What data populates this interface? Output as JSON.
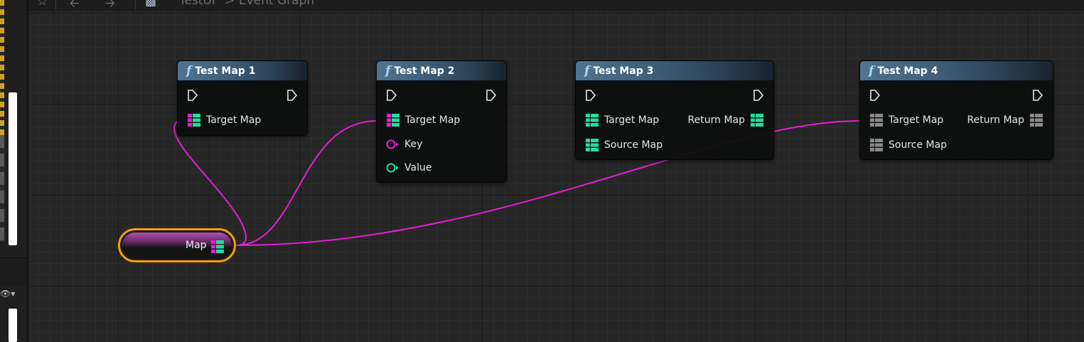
{
  "toolbar": {
    "breadcrumb_asset": "TestUI",
    "breadcrumb_separator": ">",
    "breadcrumb_graph": "Event Graph"
  },
  "colors": {
    "wire_map": "#e61ed7",
    "pin_map_key": "#e61ed7",
    "pin_map_value": "#1fe0a0",
    "pin_unlinked": "#8a8a8a",
    "var_node_border": "#f29d10"
  },
  "nodes": [
    {
      "title": "Test Map 1",
      "inputs": [
        {
          "label": "Target Map",
          "type": "map-linked"
        }
      ],
      "outputs": []
    },
    {
      "title": "Test Map 2",
      "inputs": [
        {
          "label": "Target Map",
          "type": "map-linked"
        },
        {
          "label": "Key",
          "type": "key-pin"
        },
        {
          "label": "Value",
          "type": "value-pin"
        }
      ],
      "outputs": []
    },
    {
      "title": "Test Map 3",
      "inputs": [
        {
          "label": "Target Map",
          "type": "map"
        },
        {
          "label": "Source Map",
          "type": "map"
        }
      ],
      "outputs": [
        {
          "label": "Return Map",
          "type": "map"
        }
      ]
    },
    {
      "title": "Test Map 4",
      "inputs": [
        {
          "label": "Target Map",
          "type": "map-grey"
        },
        {
          "label": "Source Map",
          "type": "map-grey"
        }
      ],
      "outputs": [
        {
          "label": "Return Map",
          "type": "map-grey"
        }
      ]
    }
  ],
  "variable_node": {
    "label": "Map"
  }
}
